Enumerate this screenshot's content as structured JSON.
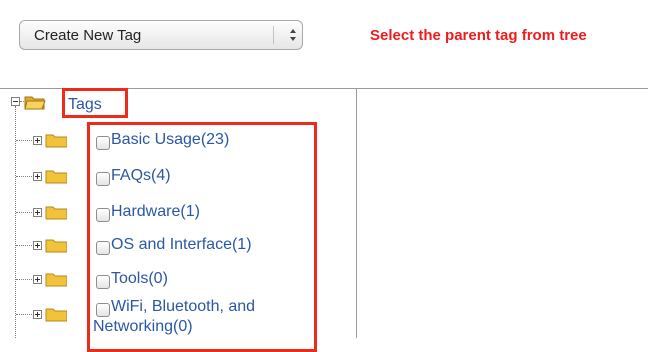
{
  "toolbar": {
    "select_value": "Create New Tag",
    "hint": "Select the parent tag from tree"
  },
  "tree": {
    "root": {
      "label": "Tags"
    },
    "children": [
      {
        "label": "Basic Usage(23)"
      },
      {
        "label": "FAQs(4)"
      },
      {
        "label": "Hardware(1)"
      },
      {
        "label": "OS and Interface(1)"
      },
      {
        "label": "Tools(0)"
      },
      {
        "label_line1": "WiFi, Bluetooth, and",
        "label_line2": "Networking(0)"
      }
    ]
  },
  "colors": {
    "highlight": "#ee2a1a",
    "hint": "#ee1c1c",
    "link": "#2a57a6",
    "folder": "#f2c23a"
  },
  "icons": [
    "stepper-icon",
    "expand-icon",
    "collapse-icon",
    "folder-icon",
    "checkbox"
  ]
}
